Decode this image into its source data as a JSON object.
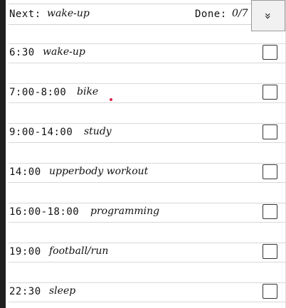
{
  "header": {
    "next_label": "Next:",
    "next_value": "wake-up",
    "done_label": "Done:",
    "done_value": "0/7",
    "toggle_icon": "chevron-double-down-icon",
    "toggle_glyph": "»"
  },
  "schedule": [
    {
      "time": "6:30",
      "task": "wake-up",
      "checked": false
    },
    {
      "time": "7:00-8:00",
      "task": "bike",
      "checked": false
    },
    {
      "time": "9:00-14:00",
      "task": "study",
      "checked": false
    },
    {
      "time": "14:00",
      "task": "upperbody workout",
      "checked": false
    },
    {
      "time": "16:00-18:00",
      "task": "programming",
      "checked": false
    },
    {
      "time": "19:00",
      "task": "football/run",
      "checked": false
    },
    {
      "time": "22:30",
      "task": "sleep",
      "checked": false
    }
  ],
  "colors": {
    "accent_dot": "#e0204a"
  }
}
